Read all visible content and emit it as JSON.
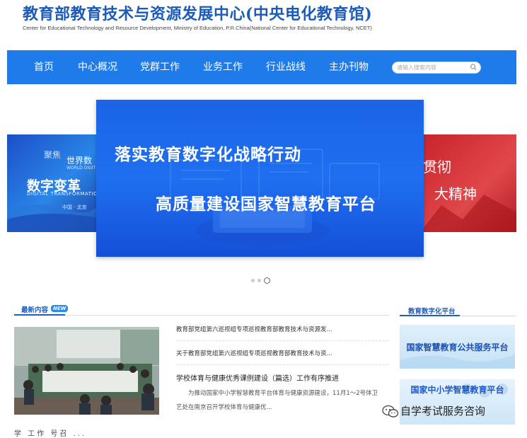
{
  "header": {
    "title": "教育部教育技术与资源发展中心(中央电化教育馆)",
    "subtitle": "Center for Educational Technology and Resource Development, Ministry of Education, P.R.China(National Center for Educational Technology, NCET)"
  },
  "nav": {
    "items": [
      {
        "label": "首页"
      },
      {
        "label": "中心概况"
      },
      {
        "label": "党群工作"
      },
      {
        "label": "业务工作"
      },
      {
        "label": "行业战线"
      },
      {
        "label": "主办刊物"
      }
    ],
    "search_placeholder": "请输入搜索内容"
  },
  "carousel": {
    "left": {
      "logo": "聚焦",
      "world": "世界数",
      "world_en": "WORLD DIGIT",
      "headline": "数字变革",
      "headline_en": "DIGITAL TRANSFORMATIO",
      "place": "中国 · 北京"
    },
    "main": {
      "line1": "落实教育数字化战略行动",
      "line2": "高质量建设国家智慧教育平台"
    },
    "right": {
      "line1": "贯彻",
      "line2": "大精神"
    },
    "active_index": 2,
    "dot_count": 3
  },
  "latest": {
    "heading": "最新内容",
    "badge": "NEW",
    "links": [
      "教育部党组第六巡视组专项巡视教育部教育技术与资源发...",
      "关于教育部党组第六巡视组专项巡视教育部教育技术与资..."
    ],
    "featured": {
      "title": "学校体育与健康优秀课例建设（篇选）工作有序推进",
      "summary_line1": "为推动国家中小学智慧教育平台体育与健康资源建设，11月1～2号体卫",
      "summary_line2": "艺处在南京召开学校体育与健康优..."
    },
    "more_row": "学 工作    号召  ..."
  },
  "sidebar": {
    "heading": "教育数字化平台",
    "banners": [
      {
        "label": "国家智慧教育公共服务平台"
      },
      {
        "label": "国家中小学智慧教育平台"
      }
    ]
  },
  "watermark": {
    "text": "自学考试服务咨询"
  },
  "colors": {
    "brand_blue": "#1f7bea",
    "title_blue": "#1c5bb8",
    "banner_red": "#c8232b"
  }
}
